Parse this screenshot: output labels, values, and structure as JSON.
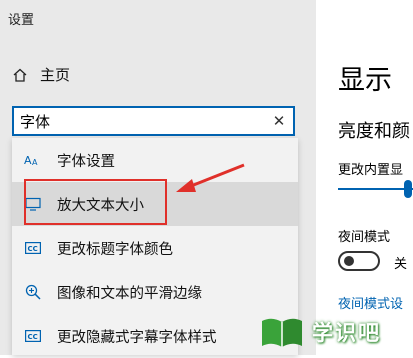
{
  "window": {
    "title": "设置"
  },
  "sidebar": {
    "home_label": "主页"
  },
  "search": {
    "value": "字体",
    "clear_icon": "✕"
  },
  "dropdown": {
    "items": [
      {
        "label": "字体设置",
        "icon": "font-icon"
      },
      {
        "label": "放大文本大小",
        "icon": "monitor-icon",
        "selected": true
      },
      {
        "label": "更改标题字体颜色",
        "icon": "cc-icon"
      },
      {
        "label": "图像和文本的平滑边缘",
        "icon": "zoom-icon"
      },
      {
        "label": "更改隐藏式字幕字体样式",
        "icon": "cc-icon"
      }
    ]
  },
  "main": {
    "title": "显示",
    "subtitle": "亮度和颜",
    "brightness_text": "更改内置显",
    "night_mode_label": "夜间模式",
    "toggle_state_label": "关",
    "night_mode_link": "夜间模式设"
  },
  "watermark": {
    "text": "学识吧"
  },
  "colors": {
    "accent": "#0063b1",
    "annotation_red": "#e0302a",
    "sidebar_bg": "#e9e9e9"
  }
}
